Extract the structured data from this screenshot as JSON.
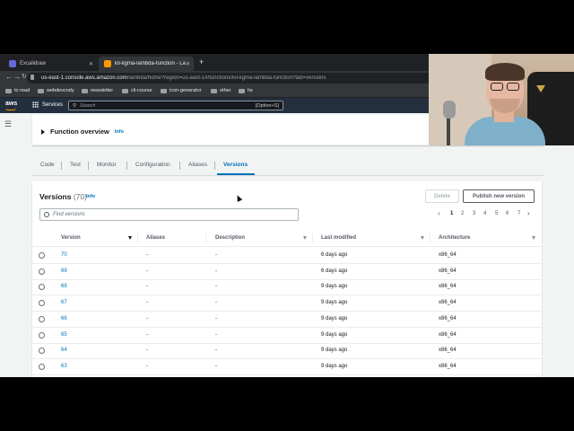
{
  "browser": {
    "tabs": [
      {
        "title": "Excalidraw",
        "favicon_color": "#6965db"
      },
      {
        "title": "lol-ligma-lambda-function - La",
        "favicon_color": "#ff9900"
      }
    ],
    "url_host": "us-east-1.console.aws.amazon.com",
    "url_path": "/lambda/home?region=us-east-1#/functions/lol-ligma-lambda-function?tab=versions",
    "bookmarks": [
      "to read",
      "webdevcody",
      "newsletter",
      "cli-course",
      "icon-generator",
      "other",
      "hs"
    ]
  },
  "aws": {
    "logo": "aws",
    "services_label": "Services",
    "search_placeholder": "Search",
    "search_hint": "[Option+S]"
  },
  "overview": {
    "title": "Function overview",
    "info": "Info"
  },
  "tabs": [
    "Code",
    "Test",
    "Monitor",
    "Configuration",
    "Aliases",
    "Versions"
  ],
  "active_tab": "Versions",
  "versions": {
    "title": "Versions",
    "count": "(70)",
    "info": "Info",
    "delete_label": "Delete",
    "publish_label": "Publish new version",
    "filter_placeholder": "Find versions",
    "pages": [
      "1",
      "2",
      "3",
      "4",
      "5",
      "6",
      "7"
    ],
    "current_page": "1",
    "columns": [
      "Version",
      "Aliases",
      "Description",
      "Last modified",
      "Architecture"
    ],
    "rows": [
      {
        "version": "70",
        "aliases": "-",
        "description": "-",
        "last_modified": "6 days ago",
        "architecture": "x86_64"
      },
      {
        "version": "69",
        "aliases": "-",
        "description": "-",
        "last_modified": "6 days ago",
        "architecture": "x86_64"
      },
      {
        "version": "68",
        "aliases": "-",
        "description": "-",
        "last_modified": "9 days ago",
        "architecture": "x86_64"
      },
      {
        "version": "67",
        "aliases": "-",
        "description": "-",
        "last_modified": "9 days ago",
        "architecture": "x86_64"
      },
      {
        "version": "66",
        "aliases": "-",
        "description": "-",
        "last_modified": "9 days ago",
        "architecture": "x86_64"
      },
      {
        "version": "65",
        "aliases": "-",
        "description": "-",
        "last_modified": "9 days ago",
        "architecture": "x86_64"
      },
      {
        "version": "64",
        "aliases": "-",
        "description": "-",
        "last_modified": "9 days ago",
        "architecture": "x86_64"
      },
      {
        "version": "63",
        "aliases": "-",
        "description": "-",
        "last_modified": "9 days ago",
        "architecture": "x86_64"
      }
    ]
  },
  "colors": {
    "link": "#0073bb",
    "aws_header": "#232f3e",
    "aws_orange": "#ff9900"
  }
}
